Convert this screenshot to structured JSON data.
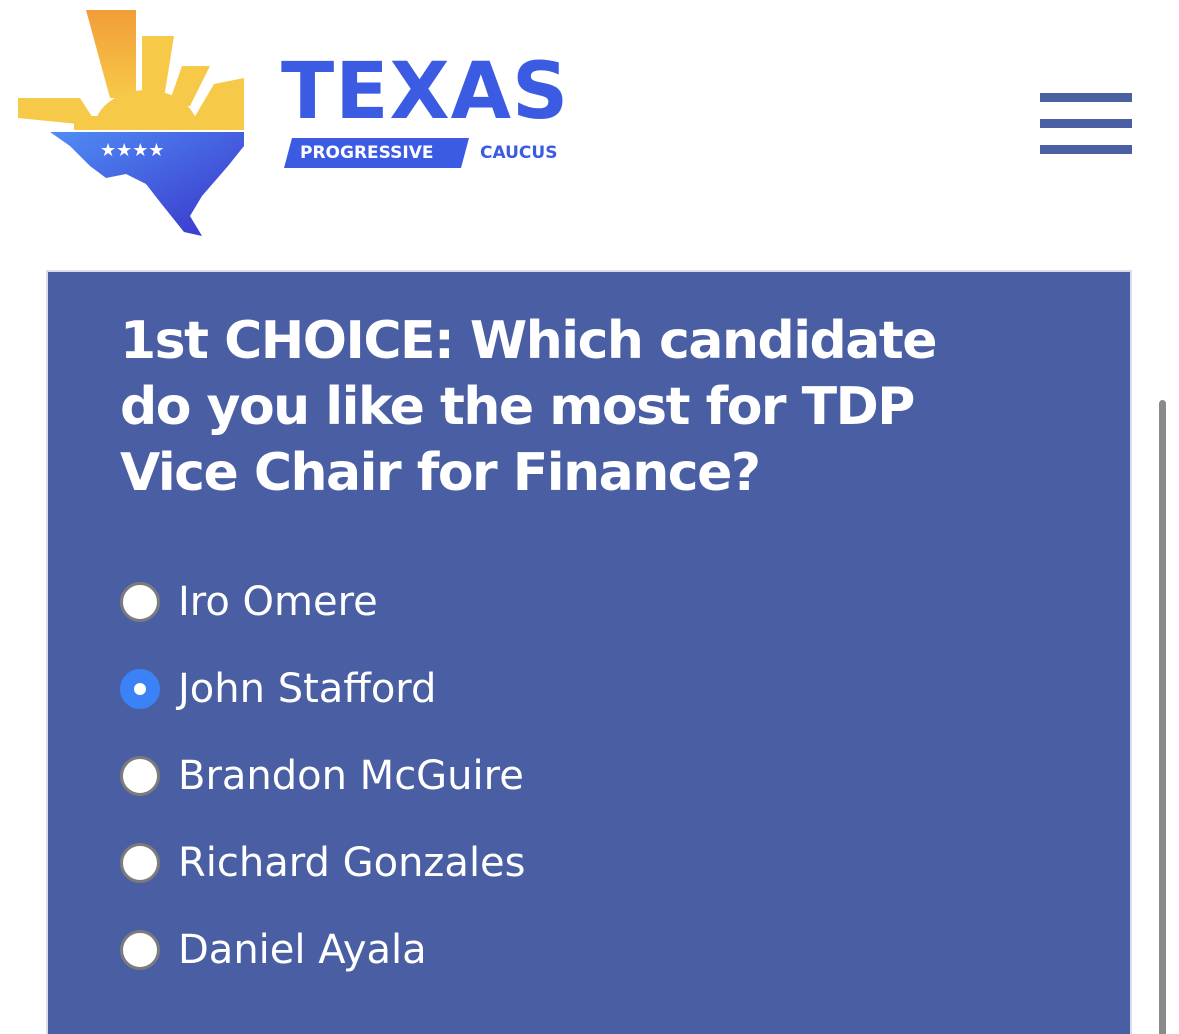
{
  "header": {
    "brand_title": "TEXAS",
    "brand_badge": "PROGRESSIVE",
    "brand_suffix": "CAUCUS",
    "logo_stars": "★★★★",
    "menu_icon": "hamburger-menu-icon"
  },
  "poll": {
    "question": "1st CHOICE: Which candidate do you like the most for TDP Vice Chair for Finance?",
    "options": [
      {
        "label": "Iro Omere",
        "selected": false
      },
      {
        "label": "John Stafford",
        "selected": true
      },
      {
        "label": "Brandon McGuire",
        "selected": false
      },
      {
        "label": "Richard Gonzales",
        "selected": false
      },
      {
        "label": "Daniel Ayala",
        "selected": false
      }
    ]
  },
  "colors": {
    "brand_blue": "#3b5be3",
    "card_bg": "#4a5ea3",
    "radio_selected": "#3b82f6",
    "sun_yellow": "#f7c948",
    "sun_orange": "#f29d38"
  }
}
